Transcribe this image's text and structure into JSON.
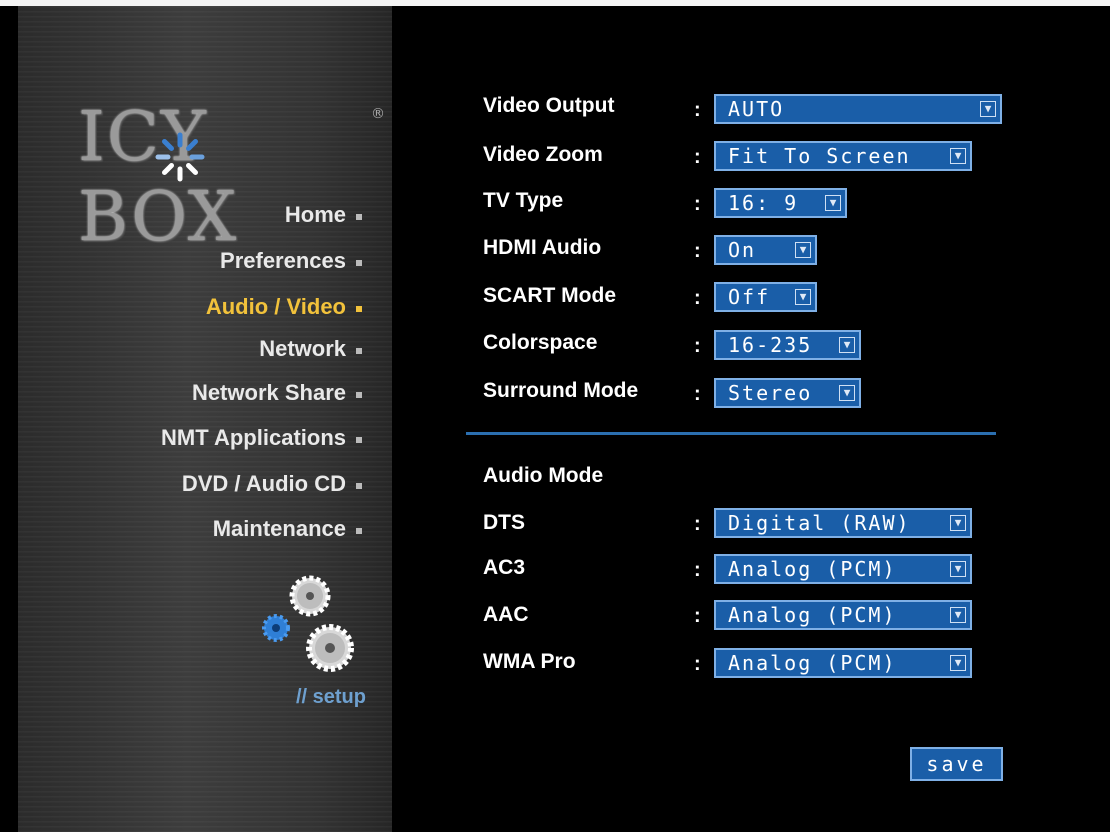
{
  "brand": {
    "logo_text": "ICY BOX",
    "registered_mark": "®"
  },
  "sidebar": {
    "items": [
      {
        "label": "Home",
        "active": false
      },
      {
        "label": "Preferences",
        "active": false
      },
      {
        "label": "Audio / Video",
        "active": true
      },
      {
        "label": "Network",
        "active": false
      },
      {
        "label": "Network Share",
        "active": false
      },
      {
        "label": "NMT Applications",
        "active": false
      },
      {
        "label": "DVD / Audio CD",
        "active": false
      },
      {
        "label": "Maintenance",
        "active": false
      }
    ],
    "setup_label": "// setup"
  },
  "video_settings": [
    {
      "label": "Video Output",
      "value": "AUTO"
    },
    {
      "label": "Video Zoom",
      "value": "Fit To Screen"
    },
    {
      "label": "TV Type",
      "value": "16: 9"
    },
    {
      "label": "HDMI Audio",
      "value": "On"
    },
    {
      "label": "SCART Mode",
      "value": "Off"
    },
    {
      "label": "Colorspace",
      "value": "16-235"
    },
    {
      "label": "Surround Mode",
      "value": "Stereo"
    }
  ],
  "audio_mode": {
    "title": "Audio Mode",
    "settings": [
      {
        "label": "DTS",
        "value": "Digital (RAW)"
      },
      {
        "label": "AC3",
        "value": "Analog (PCM)"
      },
      {
        "label": "AAC",
        "value": "Analog (PCM)"
      },
      {
        "label": "WMA Pro",
        "value": "Analog (PCM)"
      }
    ]
  },
  "colon": ":",
  "save_label": "save",
  "colors": {
    "active_nav": "#f2c23b",
    "select_bg": "#1a5ea8",
    "select_border": "#7fb0e6",
    "divider": "#2b6fb0",
    "setup_label": "#6ea0cf"
  },
  "icons": {
    "dropdown": "chevron-down-icon",
    "nav_bullet": "bullet-icon",
    "gears": "gears-icon",
    "spinner": "spinner-icon"
  }
}
